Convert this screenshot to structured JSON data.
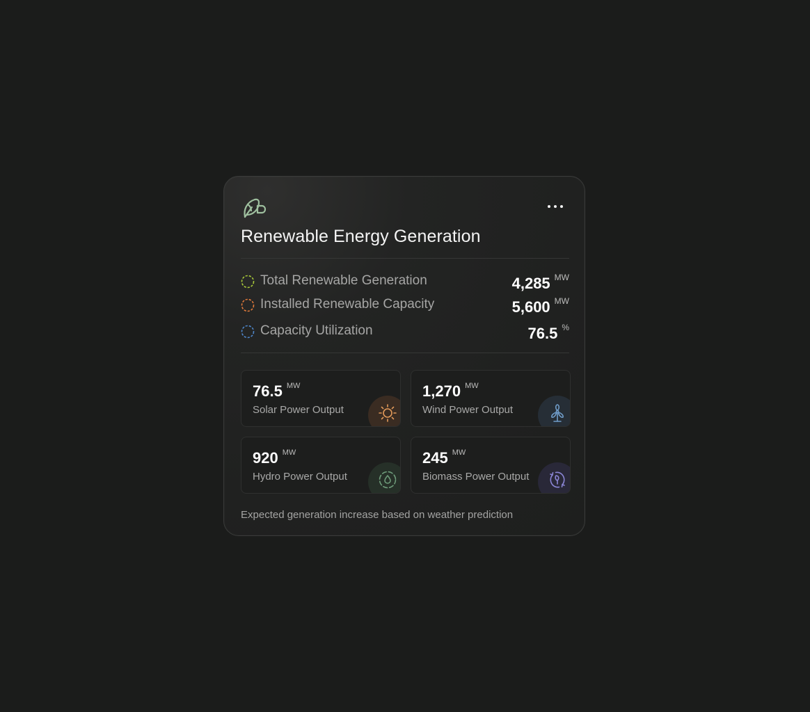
{
  "card": {
    "title": "Renewable Energy Generation",
    "icon": "leaf-plug-icon",
    "menu_icon": "more-horizontal-icon"
  },
  "stats": [
    {
      "label": "Total Renewable Generation",
      "value": "4,285",
      "unit": "MW",
      "color": "#a9c93a"
    },
    {
      "label": "Installed Renewable Capacity",
      "value": "5,600",
      "unit": "MW",
      "color": "#e07a3b"
    },
    {
      "label": "Capacity Utilization",
      "value": "76.5",
      "unit": "%",
      "color": "#4f86c9"
    }
  ],
  "tiles": [
    {
      "value": "76.5",
      "unit": "MW",
      "label": "Solar Power Output",
      "icon": "sun-icon",
      "color": "#e39a5a"
    },
    {
      "value": "1,270",
      "unit": "MW",
      "label": "Wind Power Output",
      "icon": "wind-turbine-icon",
      "color": "#6f9bc7"
    },
    {
      "value": "920",
      "unit": "MW",
      "label": "Hydro Power Output",
      "icon": "water-drop-icon",
      "color": "#6e9b7a"
    },
    {
      "value": "245",
      "unit": "MW",
      "label": "Biomass Power Output",
      "icon": "leaf-cycle-icon",
      "color": "#8b86d6"
    }
  ],
  "footer": {
    "note": "Expected generation increase based on weather prediction"
  }
}
